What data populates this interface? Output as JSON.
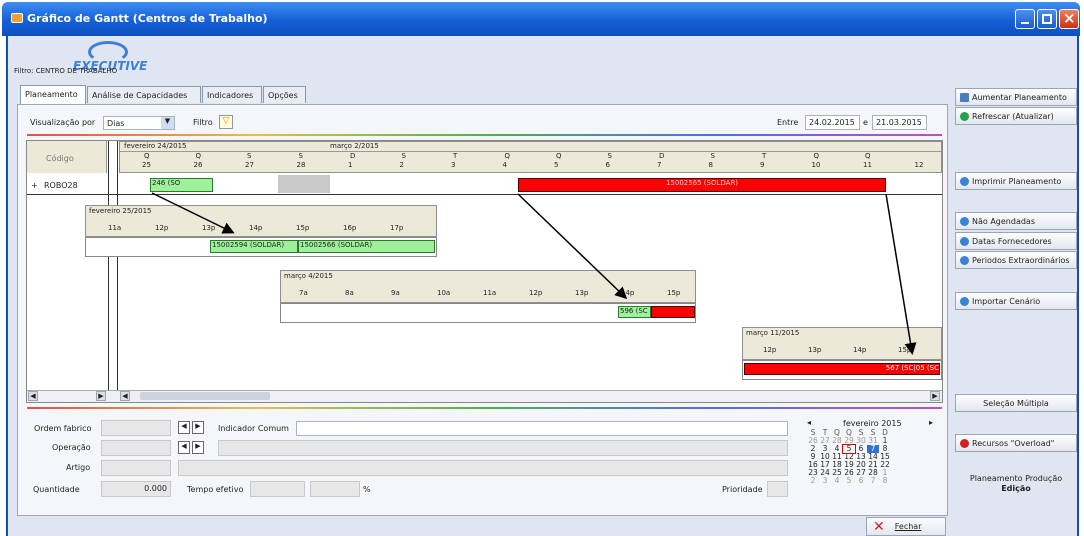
{
  "window": {
    "title": "Gráfico de Gantt (Centros de Trabalho)",
    "buttons": [
      "minimize",
      "maximize",
      "close"
    ]
  },
  "logo": {
    "text": "EXECUTIVE"
  },
  "filter_label": "Filtro: CENTRO DE TRABALHO",
  "tabs": [
    "Planeamento",
    "Análise de Capacidades",
    "Indicadores",
    "Opções"
  ],
  "toolbar": {
    "view_label": "Visualização por",
    "view_value": "Dias",
    "filter_label": "Filtro",
    "range_label": "Entre",
    "range_start": "24.02.2015",
    "range_conj": "e",
    "range_end": "21.03.2015"
  },
  "gantt": {
    "code_header": "Código",
    "row": {
      "expand": "+",
      "code": "ROBO28"
    },
    "main_week1": "fevereiro 24/2015",
    "main_week2": "março 2/2015",
    "main_days": [
      "Q",
      "Q",
      "S",
      "S",
      "D",
      "S",
      "T",
      "Q",
      "Q",
      "S",
      "D",
      "S",
      "T",
      "Q",
      "Q"
    ],
    "main_nums": [
      "25",
      "26",
      "27",
      "28",
      "1",
      "2",
      "3",
      "4",
      "5",
      "6",
      "7",
      "8",
      "9",
      "10",
      "11",
      "12"
    ],
    "main_bar1": "246 (SO",
    "main_bar2": "15002565 (SOLDAR)",
    "z1_date": "fevereiro 25/2015",
    "z1_hours": [
      "11a",
      "12p",
      "13p",
      "14p",
      "15p",
      "16p",
      "17p"
    ],
    "z1_bar1": "15002594 (SOLDAR)",
    "z1_bar2": "15002566 (SOLDAR)",
    "z2_date": "março 4/2015",
    "z2_hours": [
      "7a",
      "8a",
      "9a",
      "10a",
      "11a",
      "12p",
      "13p",
      "14p",
      "15p"
    ],
    "z2_bar1": "596 (SC",
    "z3_date": "março 11/2015",
    "z3_hours": [
      "12p",
      "13p",
      "14p",
      "15p"
    ],
    "z3_bar1": "567 (SC",
    "z3_bar2": "05 (SC"
  },
  "form": {
    "ordem": "Ordem fabrico",
    "operacao": "Operação",
    "artigo": "Artigo",
    "quantidade": "Quantidade",
    "quantidade_val": "0.000",
    "tempo": "Tempo efetivo",
    "percent": "%",
    "indicador": "Indicador Comum",
    "prioridade": "Prioridade"
  },
  "calendar": {
    "month": "fevereiro 2015",
    "headers": [
      "S",
      "T",
      "Q",
      "Q",
      "S",
      "S",
      "D"
    ],
    "rows": [
      [
        "26",
        "27",
        "28",
        "29",
        "30",
        "31",
        "1"
      ],
      [
        "2",
        "3",
        "4",
        "5",
        "6",
        "7",
        "8"
      ],
      [
        "9",
        "10",
        "11",
        "12",
        "13",
        "14",
        "15"
      ],
      [
        "16",
        "17",
        "18",
        "19",
        "20",
        "21",
        "22"
      ],
      [
        "23",
        "24",
        "25",
        "26",
        "27",
        "28",
        "1"
      ],
      [
        "2",
        "3",
        "4",
        "5",
        "6",
        "7",
        "8"
      ]
    ],
    "today": "5",
    "selected": "7"
  },
  "sidebar": {
    "b1": "Aumentar Planeamento",
    "b2": "Refrescar (Atualizar)",
    "b3": "Imprimir Planeamento",
    "b4": "Não Agendadas",
    "b5": "Datas Fornecedores",
    "b6": "Periodos Extraordinários",
    "b7": "Importar Cenário",
    "b8": "Seleção Múltipla",
    "b9": "Recursos \"Overload\"",
    "mode1": "Planeamento Produção",
    "mode2": "Edição"
  },
  "close": "Fechar"
}
